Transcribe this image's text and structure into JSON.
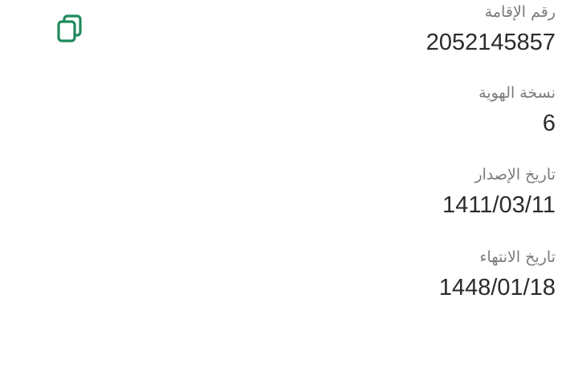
{
  "copy_button": {
    "icon": "copy-icon",
    "color": "#1f8a5b"
  },
  "fields": [
    {
      "label": "رقم الإقامة",
      "value": "2052145857"
    },
    {
      "label": "نسخة الهوية",
      "value": "6"
    },
    {
      "label": "تاريخ الإصدار",
      "value": "1411/03/11"
    },
    {
      "label": "تاريخ الانتهاء",
      "value": "1448/01/18"
    }
  ]
}
